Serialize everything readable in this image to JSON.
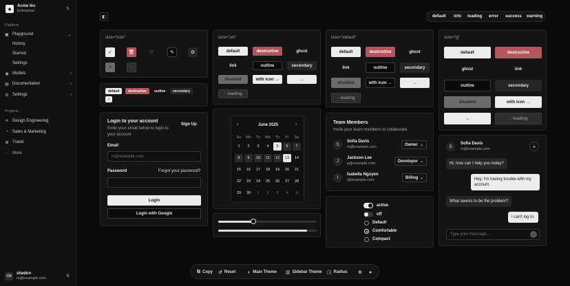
{
  "sidebar": {
    "team_name": "Acme Inc",
    "team_plan": "Enterprise",
    "platform_label": "Platform",
    "nav": [
      {
        "label": "Playground"
      },
      {
        "label": "Models"
      },
      {
        "label": "Documentation"
      },
      {
        "label": "Settings"
      }
    ],
    "playground_sub": [
      "History",
      "Starred",
      "Settings"
    ],
    "projects_label": "Projects",
    "projects": [
      "Design Engineering",
      "Sales & Marketing",
      "Travel"
    ],
    "more_label": "More",
    "user_name": "shadcn",
    "user_email": "m@example.com",
    "user_initials": "CN"
  },
  "status_tabs": [
    "default",
    "info",
    "loading",
    "error",
    "success",
    "warning"
  ],
  "icon_card": {
    "label": "size=\"icon\""
  },
  "sm_card": {
    "label": "size=\"sm\"",
    "default": "default",
    "destructive": "destructive",
    "ghost": "ghost",
    "link": "link",
    "outline": "outline",
    "secondary": "secondary",
    "disabled": "disabled",
    "with_icon": "with icon",
    "loading": "loading"
  },
  "default_card": {
    "label": "size=\"default\"",
    "default": "default",
    "destructive": "destructive",
    "ghost": "ghost",
    "link": "link",
    "outline": "outline",
    "secondary": "secondary",
    "disabled": "disabled",
    "with_icon": "with icon",
    "loading": "loading"
  },
  "lg_card": {
    "label": "size=\"lg\"",
    "default": "default",
    "destructive": "destructive",
    "ghost": "ghost",
    "link": "link",
    "outline": "outline",
    "secondary": "secondary",
    "disabled": "disabled",
    "with_icon": "with icon",
    "loading": "loading"
  },
  "badges": [
    "default",
    "destructive",
    "outline",
    "secondary"
  ],
  "login": {
    "title": "Login to your account",
    "subtitle": "Enter your email below to login to your account",
    "signup": "Sign Up",
    "email_label": "Email",
    "email_placeholder": "m@example.com",
    "password_label": "Password",
    "forgot": "Forgot your password?",
    "login_button": "Login",
    "google_button": "Login with Google"
  },
  "calendar": {
    "month": "June 2025",
    "weekdays": [
      "Su",
      "Mo",
      "Tu",
      "We",
      "Th",
      "Fr",
      "Sa"
    ],
    "weeks": [
      [
        "1",
        "2",
        "3",
        "4",
        "5",
        "6",
        "7"
      ],
      [
        "8",
        "9",
        "10",
        "11",
        "12",
        "13",
        "14"
      ],
      [
        "15",
        "16",
        "17",
        "18",
        "19",
        "20",
        "21"
      ],
      [
        "22",
        "23",
        "24",
        "25",
        "26",
        "27",
        "28"
      ],
      [
        "29",
        "30",
        "1",
        "2",
        "3",
        "4",
        "5"
      ]
    ]
  },
  "sliders": {
    "first": 0.36,
    "second_start": 0.0,
    "second_end": 0.9
  },
  "team": {
    "title": "Team Members",
    "subtitle": "Invite your team members to collaborate.",
    "members": [
      {
        "initial": "S",
        "name": "Sofia Davis",
        "email": "m@example.com",
        "role": "Owner"
      },
      {
        "initial": "J",
        "name": "Jackson Lee",
        "email": "p@example.com",
        "role": "Developer"
      },
      {
        "initial": "I",
        "name": "Isabella Nguyen",
        "email": "i@example.com",
        "role": "Billing"
      }
    ]
  },
  "toggles": {
    "switch_on": "active",
    "switch_off": "off",
    "radios": [
      "Default",
      "Comfortable",
      "Compact"
    ]
  },
  "chat": {
    "name": "Sofia Davis",
    "email": "m@example.com",
    "initial": "S",
    "messages": [
      {
        "from": "agent",
        "text": "Hi, how can I help you today?"
      },
      {
        "from": "user",
        "text": "Hey, I'm having trouble with my account."
      },
      {
        "from": "agent",
        "text": "What seems to be the problem?"
      },
      {
        "from": "user",
        "text": "I can't log in."
      }
    ],
    "placeholder": "Type your message..."
  },
  "bottom_toolbar": {
    "copy": "Copy",
    "reset": "Reset",
    "main_theme": "Main Theme",
    "sidebar_theme": "Sidebar Theme",
    "radius": "Radius"
  }
}
